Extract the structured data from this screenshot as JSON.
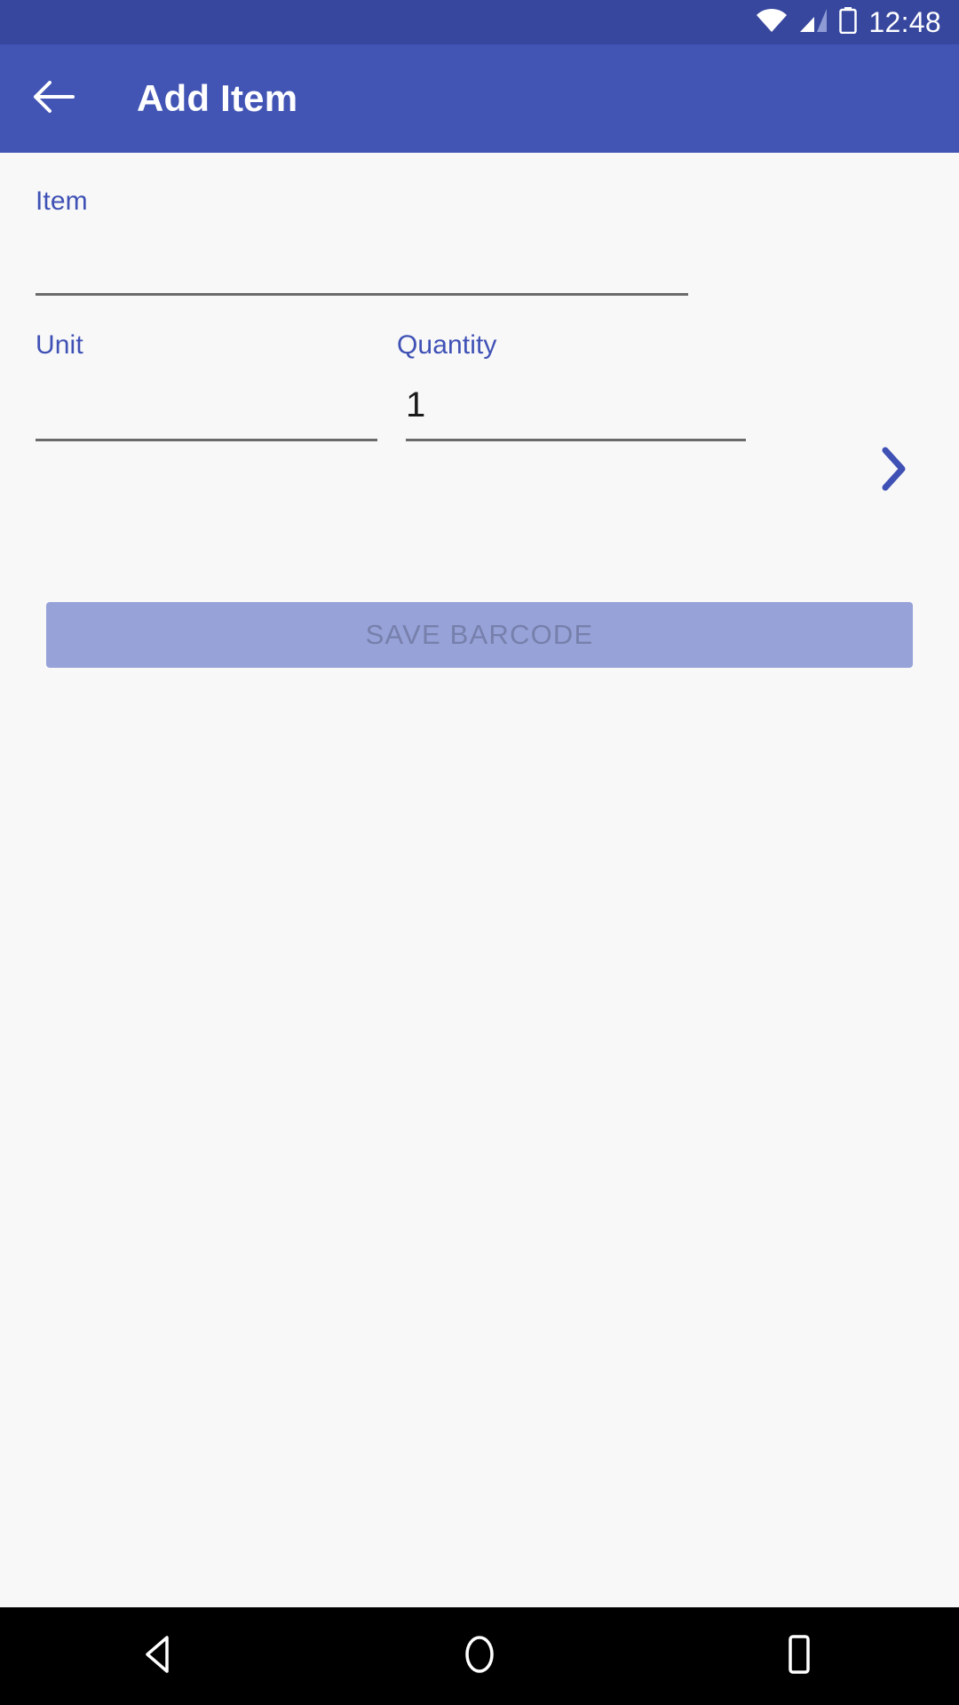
{
  "status_bar": {
    "time": "12:48",
    "icons": [
      {
        "name": "wifi-icon",
        "label": "wifi-full"
      },
      {
        "name": "cellular-signal-icon",
        "label": "signal-partial"
      },
      {
        "name": "battery-charging-icon",
        "label": "battery-charging"
      }
    ],
    "background_color": "#37479e"
  },
  "app_bar": {
    "title": "Add Item",
    "back_icon": "arrow-left-icon",
    "background_color": "#4255b5",
    "text_color": "#ffffff"
  },
  "form": {
    "accent_color": "#3f51b5",
    "fields": [
      {
        "label": "Item",
        "value": "",
        "placeholder": "",
        "trailing_icon": "chevron-right-icon"
      },
      {
        "label": "Unit",
        "value": "",
        "placeholder": ""
      },
      {
        "label": "Quantity",
        "value": "1",
        "placeholder": ""
      }
    ]
  },
  "save_button": {
    "label": "SAVE BARCODE",
    "enabled": false,
    "background_color": "#97a2d8",
    "text_color": "#7780ab"
  },
  "nav_bar": {
    "background_color": "#000000",
    "buttons": [
      {
        "name": "nav-back-button",
        "icon": "triangle-left-icon"
      },
      {
        "name": "nav-home-button",
        "icon": "circle-icon"
      },
      {
        "name": "nav-recents-button",
        "icon": "square-icon"
      }
    ]
  }
}
